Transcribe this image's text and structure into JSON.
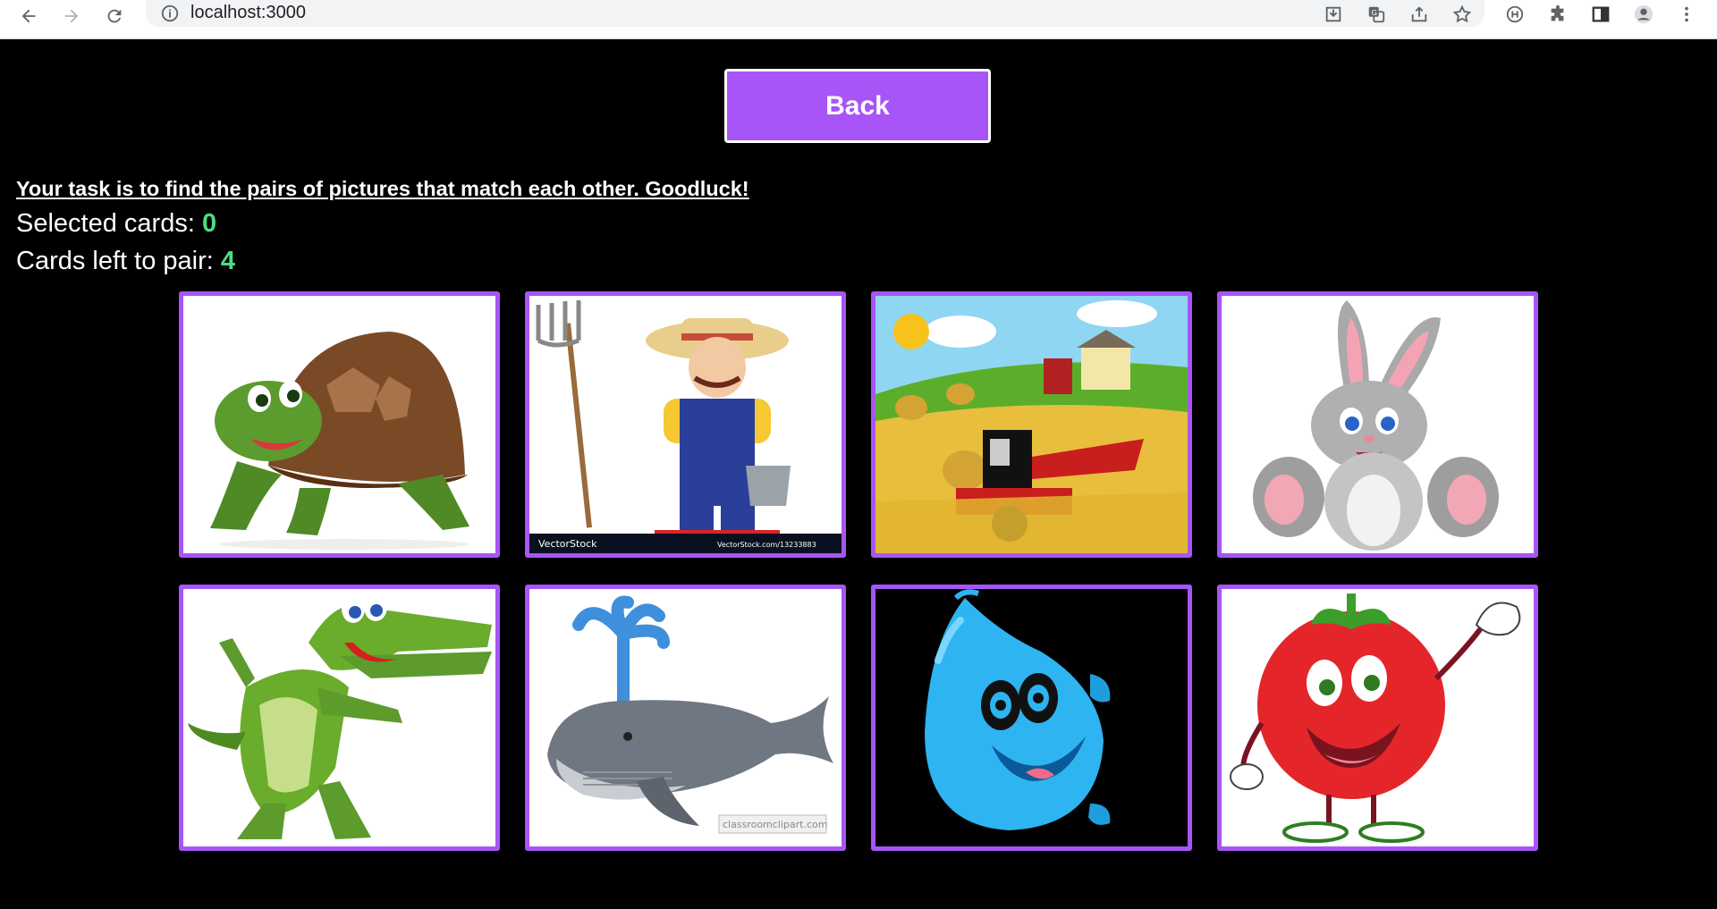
{
  "browser": {
    "url": "localhost:3000",
    "icons": [
      "back-arrow-icon",
      "forward-arrow-icon",
      "reload-icon",
      "info-icon",
      "download-icon",
      "translate-icon",
      "share-icon",
      "star-icon",
      "extension-h-icon",
      "puzzle-icon",
      "sidepanel-icon",
      "profile-icon",
      "menu-icon"
    ]
  },
  "page": {
    "back_label": "Back",
    "task_text": "Your task is to find the pairs of pictures that match each other. Goodluck!",
    "selected_label": "Selected cards: ",
    "selected_value": "0",
    "left_label": "Cards left to pair: ",
    "left_value": "4"
  },
  "cards": [
    {
      "picture": "turtle",
      "watermark": ""
    },
    {
      "picture": "farmer",
      "watermark": "VectorStock",
      "watermark_right": "VectorStock.com/13233883"
    },
    {
      "picture": "farm-harvester",
      "watermark": ""
    },
    {
      "picture": "bunny",
      "watermark": ""
    },
    {
      "picture": "crocodile",
      "watermark": ""
    },
    {
      "picture": "whale",
      "watermark": "classroomclipart.com"
    },
    {
      "picture": "water-drop",
      "watermark": ""
    },
    {
      "picture": "tomato",
      "watermark": ""
    }
  ],
  "colors": {
    "accent": "#a855f7",
    "count": "#4ade80",
    "background": "#000000"
  }
}
